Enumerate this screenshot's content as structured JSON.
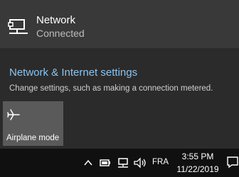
{
  "network": {
    "name": "Network",
    "status": "Connected",
    "icon": "ethernet-icon"
  },
  "settings": {
    "link": "Network & Internet settings",
    "description": "Change settings, such as making a connection metered."
  },
  "quick_actions": [
    {
      "label": "Airplane mode",
      "icon": "airplane-icon"
    }
  ],
  "taskbar": {
    "language": "FRA",
    "time": "3:55 PM",
    "date": "11/22/2019"
  },
  "colors": {
    "accent_link": "#8ec4ee",
    "flyout_bg": "#2b2b2b",
    "taskbar_bg": "#101010"
  }
}
